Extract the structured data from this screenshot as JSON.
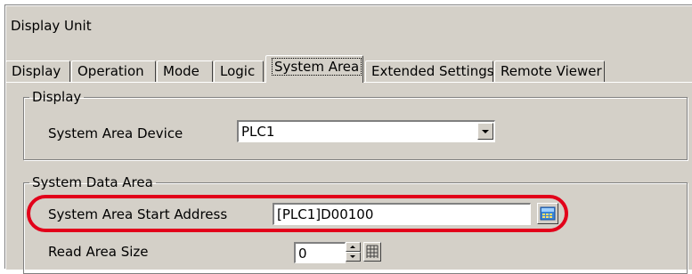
{
  "window": {
    "title": "Display Unit"
  },
  "tabs": [
    {
      "label": "Display",
      "active": false
    },
    {
      "label": "Operation",
      "active": false
    },
    {
      "label": "Mode",
      "active": false
    },
    {
      "label": "Logic",
      "active": false
    },
    {
      "label": "System Area",
      "active": true
    },
    {
      "label": "Extended Settings",
      "active": false
    },
    {
      "label": "Remote Viewer",
      "active": false
    }
  ],
  "display_group": {
    "legend": "Display",
    "device_label": "System Area Device",
    "device_value": "PLC1"
  },
  "system_data_group": {
    "legend": "System Data Area",
    "start_address_label": "System Area Start Address",
    "start_address_value": "[PLC1]D00100",
    "read_size_label": "Read Area Size",
    "read_size_value": "0"
  },
  "colors": {
    "highlight": "#e2001a",
    "face": "#d4d0c8"
  }
}
